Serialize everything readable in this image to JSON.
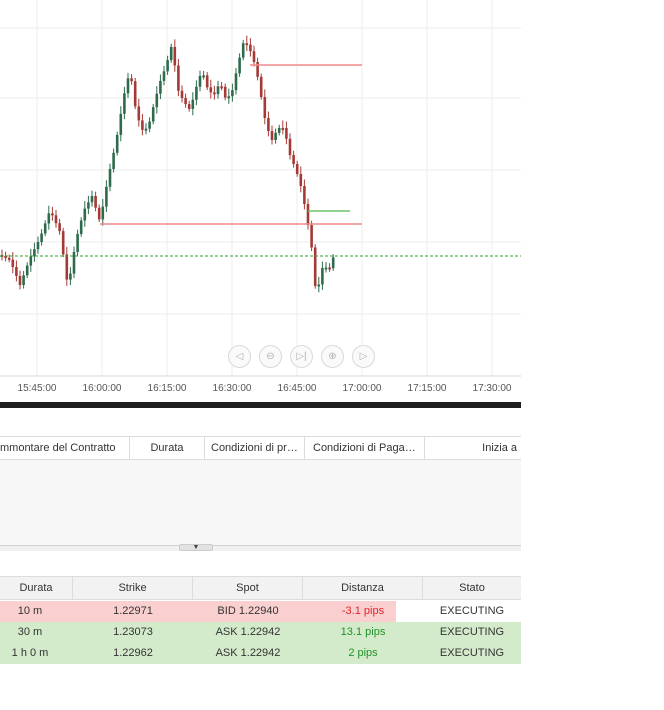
{
  "colors": {
    "bullish": "#2e6b4c",
    "bearish": "#a43a36",
    "grid": "#ececec",
    "strike_line": "#f08a8a",
    "target_line": "#6cc36c",
    "spot_line": "#2ea52e",
    "row_loss": "#f9cfcf",
    "row_win": "#d3ebcb",
    "text_red": "#e0262c",
    "text_green": "#21912a"
  },
  "chart": {
    "time_ticks": [
      "15:45:00",
      "16:00:00",
      "16:15:00",
      "16:30:00",
      "16:45:00",
      "17:00:00",
      "17:15:00",
      "17:30:00"
    ],
    "nav_icons": [
      "chevron-left-icon",
      "zoom-out-icon",
      "skip-to-end-icon",
      "zoom-in-icon",
      "chevron-right-icon"
    ]
  },
  "contract_table": {
    "columns": [
      "mmontare del Contratto",
      "Durata",
      "Condizioni di pr…",
      "Condizioni di Paga…",
      "Inizia a"
    ]
  },
  "orders_table": {
    "columns": [
      "Durata",
      "Strike",
      "Spot",
      "Distanza",
      "Stato"
    ],
    "rows": [
      {
        "durata": "10 m",
        "strike": "1.22971",
        "spot": "BID 1.22940",
        "distanza": "-3.1 pips",
        "stato": "EXECUTING",
        "result": "loss"
      },
      {
        "durata": "30 m",
        "strike": "1.23073",
        "spot": "ASK 1.22942",
        "distanza": "13.1 pips",
        "stato": "EXECUTING",
        "result": "win"
      },
      {
        "durata": "1 h 0 m",
        "strike": "1.22962",
        "spot": "ASK 1.22942",
        "distanza": "2 pips",
        "stato": "EXECUTING",
        "result": "win"
      }
    ]
  }
}
